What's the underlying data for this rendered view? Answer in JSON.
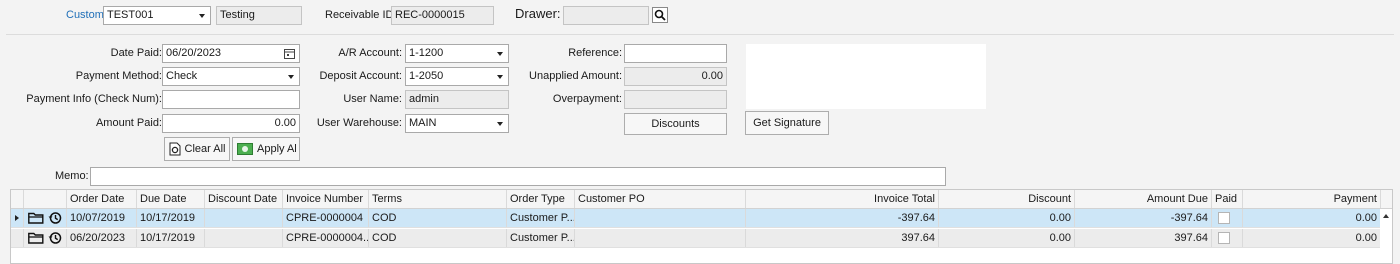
{
  "header": {
    "customer_label": "Customer:",
    "customer_value": "TEST001",
    "customer_name": "Testing",
    "receivable_label": "Receivable ID:",
    "receivable_value": "REC-0000015",
    "drawer_label": "Drawer:",
    "drawer_value": ""
  },
  "form": {
    "date_paid_label": "Date Paid:",
    "date_paid": "06/20/2023",
    "payment_method_label": "Payment Method:",
    "payment_method": "Check",
    "payment_info_label": "Payment Info (Check Num):",
    "payment_info": "",
    "amount_paid_label": "Amount Paid:",
    "amount_paid": "0.00",
    "ar_account_label": "A/R Account:",
    "ar_account": "1-1200",
    "deposit_account_label": "Deposit Account:",
    "deposit_account": "1-2050",
    "user_name_label": "User Name:",
    "user_name": "admin",
    "user_warehouse_label": "User Warehouse:",
    "user_warehouse": "MAIN",
    "reference_label": "Reference:",
    "reference": "",
    "unapplied_label": "Unapplied Amount:",
    "unapplied": "0.00",
    "overpayment_label": "Overpayment:",
    "overpayment": "",
    "memo_label": "Memo:",
    "memo": ""
  },
  "buttons": {
    "clear_all": "Clear All",
    "apply_all": "Apply Al",
    "discounts": "Discounts",
    "get_signature": "Get Signature"
  },
  "grid": {
    "columns": [
      "Order Date",
      "Due Date",
      "Discount Date",
      "Invoice Number",
      "Terms",
      "Order Type",
      "Customer PO",
      "Invoice Total",
      "Discount",
      "Amount Due",
      "Paid",
      "Payment"
    ],
    "rows": [
      {
        "order_date": "10/07/2019",
        "due_date": "10/17/2019",
        "discount_date": "",
        "invoice_number": "CPRE-0000004",
        "terms": "COD",
        "order_type": "Customer P...",
        "customer_po": "",
        "invoice_total": "-397.64",
        "discount": "0.00",
        "amount_due": "-397.64",
        "paid": false,
        "payment": "0.00"
      },
      {
        "order_date": "06/20/2023",
        "due_date": "10/17/2019",
        "discount_date": "",
        "invoice_number": "CPRE-0000004...",
        "terms": "COD",
        "order_type": "Customer P...",
        "customer_po": "",
        "invoice_total": "397.64",
        "discount": "0.00",
        "amount_due": "397.64",
        "paid": false,
        "payment": "0.00"
      }
    ]
  },
  "icons": {
    "drawer_lookup": "search-icon",
    "date_picker": "calendar-icon",
    "clear_all": "clear-icon",
    "apply_all": "apply-icon",
    "row_open": "folder-icon",
    "row_history": "history-icon"
  },
  "colors": {
    "accent_label": "#1f6fb8",
    "selected_row": "#cde6f7"
  }
}
